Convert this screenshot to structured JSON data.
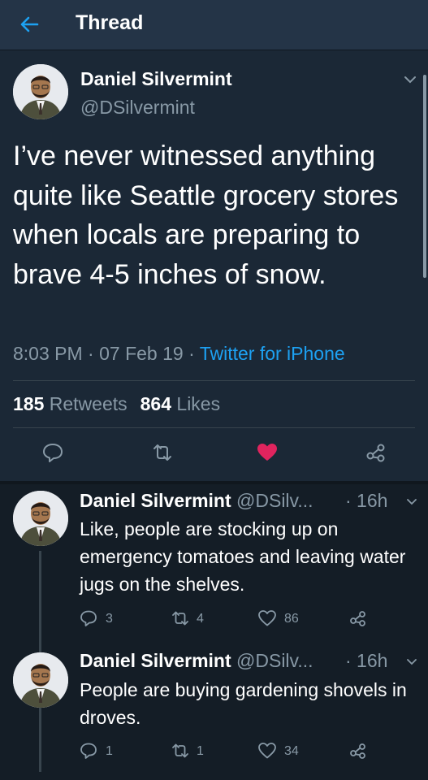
{
  "header": {
    "title": "Thread"
  },
  "main_tweet": {
    "name": "Daniel Silvermint",
    "handle": "@DSilvermint",
    "text": "I’ve never witnessed anything quite like Seattle grocery stores when locals are preparing to brave 4-5 inches of snow.",
    "time": "8:03 PM · 07 Feb 19 · ",
    "source": "Twitter for iPhone",
    "retweets_count": "185",
    "retweets_label": "Retweets",
    "likes_count": "864",
    "likes_label": "Likes"
  },
  "replies": [
    {
      "name": "Daniel Silvermint",
      "handle": "@DSilv...",
      "time": "· 16h",
      "text": "Like, people are stocking up on emergency tomatoes and leaving water jugs on the shelves.",
      "reply_count": "3",
      "retweet_count": "4",
      "like_count": "86"
    },
    {
      "name": "Daniel Silvermint",
      "handle": "@DSilv...",
      "time": "· 16h",
      "text": "People are buying gardening shovels in droves.",
      "reply_count": "1",
      "retweet_count": "1",
      "like_count": "34"
    }
  ],
  "colors": {
    "background": "#141d26",
    "card": "#1b2836",
    "header": "#243447",
    "accent": "#1da1f2",
    "like": "#e0245e",
    "muted": "#8899a6"
  }
}
